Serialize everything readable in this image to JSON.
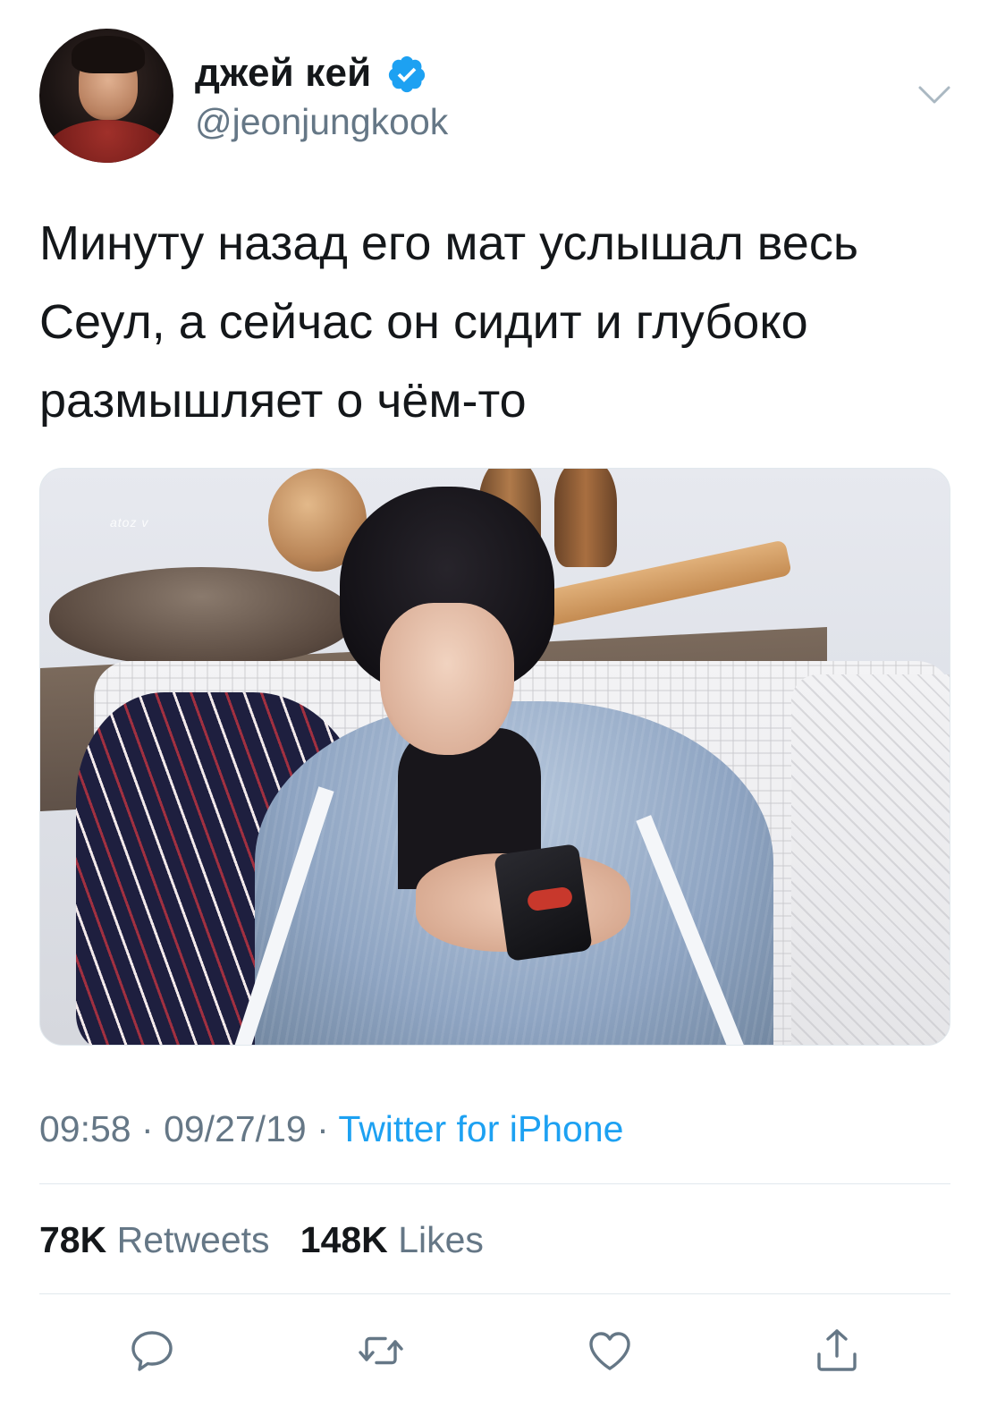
{
  "user": {
    "display_name": "джей кей",
    "handle": "@jeonjungkook",
    "verified": true
  },
  "tweet": {
    "text": "Минуту назад его мат услышал весь\nСеул, а сейчас он сидит и глубоко\nразмышляет о чём-то",
    "media_watermark": "atoz v",
    "time": "09:58",
    "date": "09/27/19",
    "separator": "·",
    "source": "Twitter for iPhone"
  },
  "stats": {
    "retweets_count": "78K",
    "retweets_label": "Retweets",
    "likes_count": "148K",
    "likes_label": "Likes"
  },
  "actions": [
    {
      "name": "reply",
      "icon": "speech-bubble-icon"
    },
    {
      "name": "retweet",
      "icon": "retweet-arrows-icon"
    },
    {
      "name": "like",
      "icon": "heart-icon"
    },
    {
      "name": "share",
      "icon": "share-upload-icon"
    }
  ],
  "colors": {
    "accent": "#1da1f2",
    "secondary_text": "#657786",
    "primary_text": "#14171a",
    "divider": "#e1e8ed"
  }
}
